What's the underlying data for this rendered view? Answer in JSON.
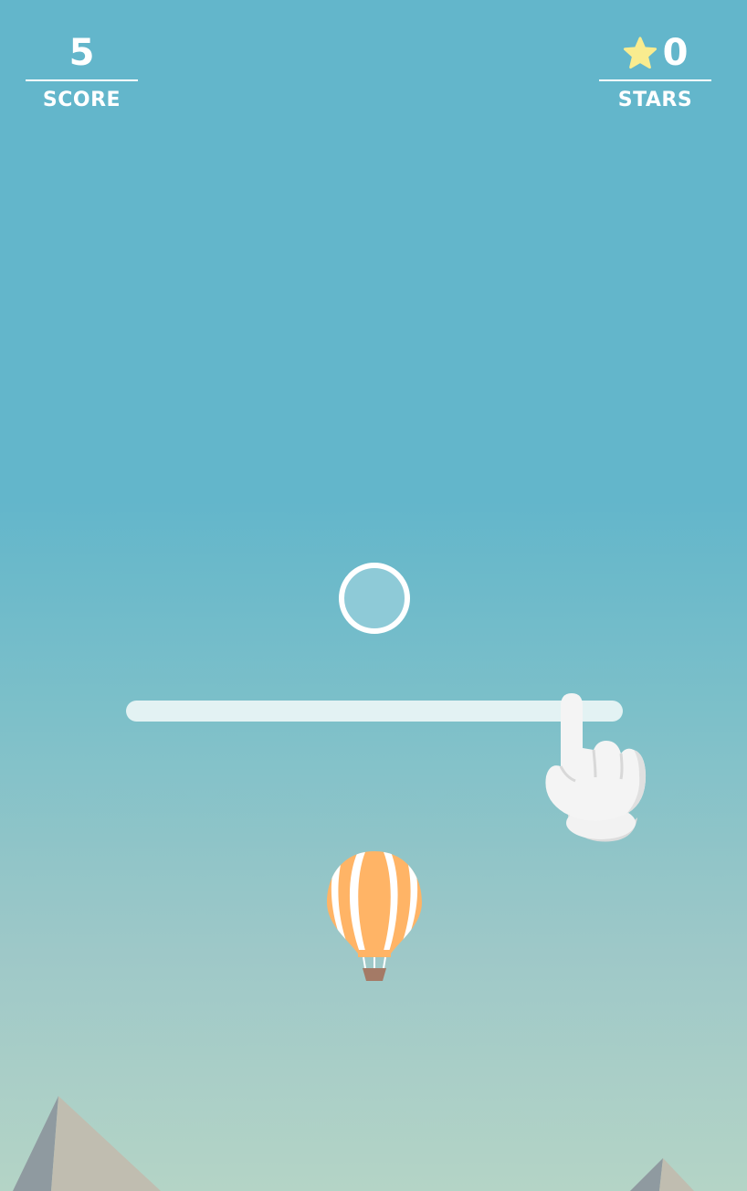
{
  "hud": {
    "score": {
      "value": "5",
      "label": "SCORE"
    },
    "stars": {
      "value": "0",
      "label": "STARS",
      "icon": "star-icon"
    }
  },
  "colors": {
    "sky_top": "#63b6cb",
    "sky_bottom": "#b4d4c6",
    "balloon_stripe": "#ffb466",
    "balloon_white": "#ffffff",
    "basket": "#a47a66",
    "star": "#f9ec8f",
    "track": "#e3f2f3"
  },
  "tutorial": {
    "gesture": "swipe",
    "icons": [
      "target-ring-icon",
      "pointing-hand-icon"
    ]
  },
  "player": {
    "icon": "hot-air-balloon-icon"
  },
  "scenery": {
    "icon": "mountains-icon"
  }
}
